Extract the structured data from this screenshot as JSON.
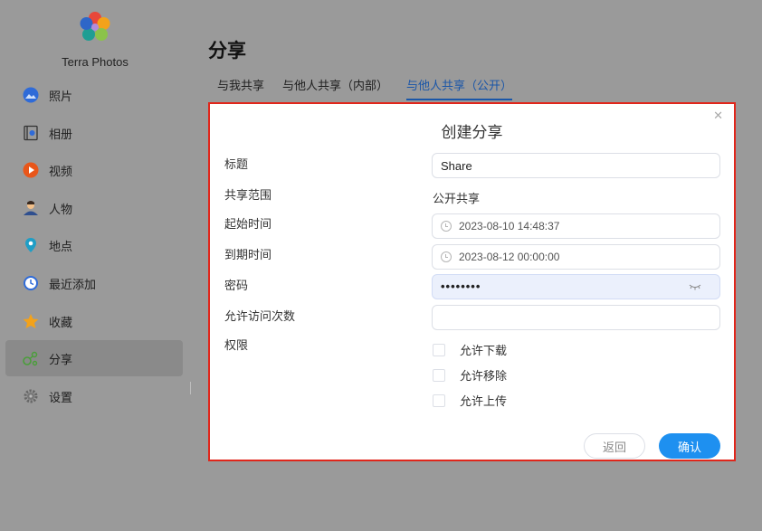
{
  "app": {
    "name": "Terra Photos"
  },
  "sidebar": {
    "items": [
      {
        "label": "照片",
        "icon": "photo-icon",
        "active": false
      },
      {
        "label": "相册",
        "icon": "album-icon",
        "active": false
      },
      {
        "label": "视频",
        "icon": "video-icon",
        "active": false
      },
      {
        "label": "人物",
        "icon": "people-icon",
        "active": false
      },
      {
        "label": "地点",
        "icon": "location-icon",
        "active": false
      },
      {
        "label": "最近添加",
        "icon": "recent-icon",
        "active": false
      },
      {
        "label": "收藏",
        "icon": "star-icon",
        "active": false
      },
      {
        "label": "分享",
        "icon": "share-icon",
        "active": true
      },
      {
        "label": "设置",
        "icon": "gear-icon",
        "active": false
      }
    ]
  },
  "header": {
    "title": "分享",
    "tabs": [
      {
        "label": "与我共享",
        "active": false
      },
      {
        "label": "与他人共享（内部）",
        "active": false
      },
      {
        "label": "与他人共享（公开）",
        "active": true
      }
    ]
  },
  "dialog": {
    "title": "创建分享",
    "close_icon": "close-icon",
    "fields": {
      "title": {
        "label": "标题",
        "value": "Share"
      },
      "scope": {
        "label": "共享范围",
        "value": "公开共享"
      },
      "start_time": {
        "label": "起始时间",
        "value": "2023-08-10 14:48:37"
      },
      "expiry_time": {
        "label": "到期时间",
        "value": "2023-08-12 00:00:00"
      },
      "password": {
        "label": "密码",
        "value": "••••••••"
      },
      "visit_limit": {
        "label": "允许访问次数",
        "value": ""
      },
      "permissions": {
        "label": "权限"
      }
    },
    "permissions": [
      {
        "label": "允许下载",
        "checked": false
      },
      {
        "label": "允许移除",
        "checked": false
      },
      {
        "label": "允许上传",
        "checked": false
      }
    ],
    "buttons": {
      "back": "返回",
      "confirm": "确认"
    }
  },
  "colors": {
    "accent": "#1e90f0",
    "highlight_border": "#e0261b",
    "tab_active": "#1a56a8"
  }
}
